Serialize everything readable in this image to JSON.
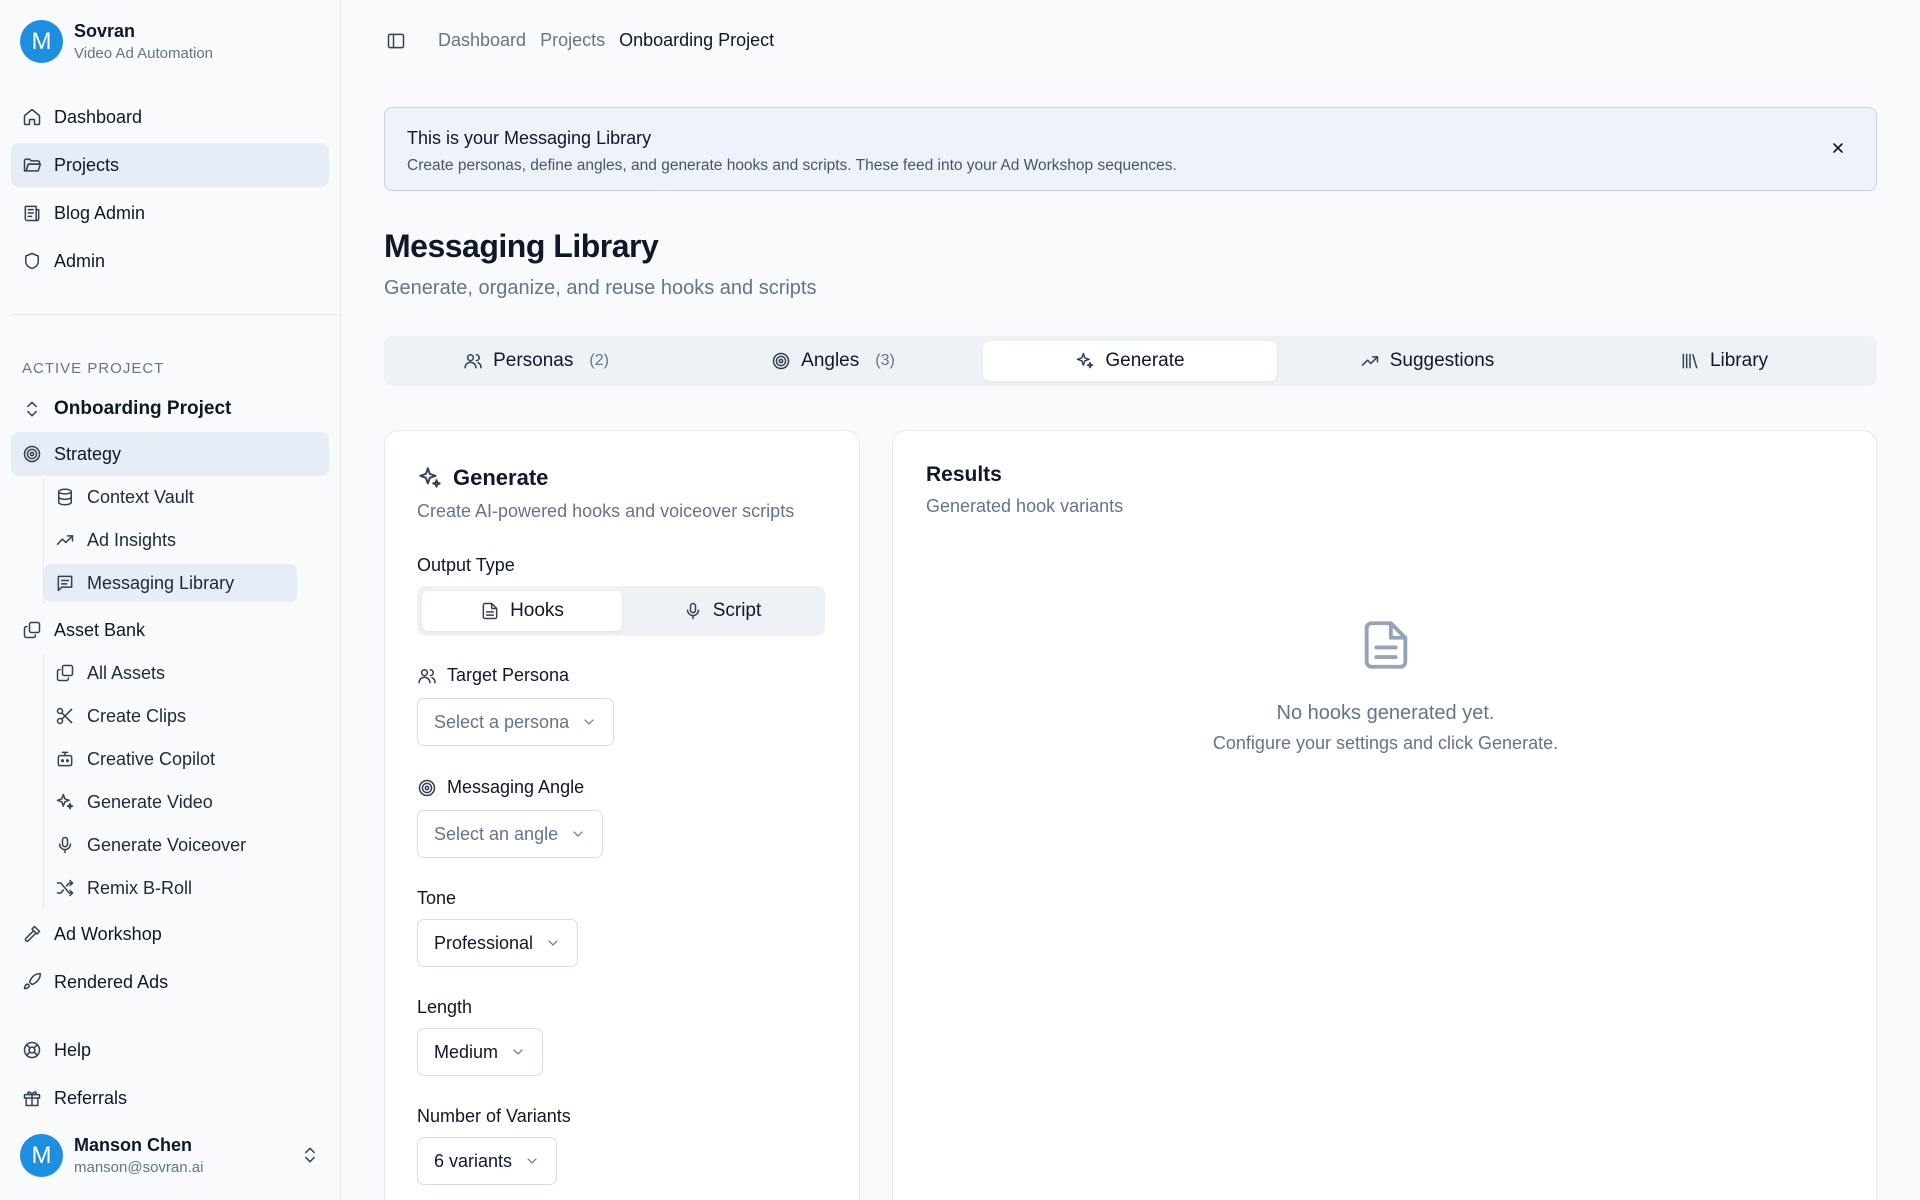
{
  "brand": {
    "initial": "M",
    "name": "Sovran",
    "subtitle": "Video Ad Automation"
  },
  "nav": [
    {
      "label": "Dashboard",
      "icon": "home-icon"
    },
    {
      "label": "Projects",
      "icon": "folder-icon"
    },
    {
      "label": "Blog Admin",
      "icon": "newspaper-icon"
    },
    {
      "label": "Admin",
      "icon": "shield-icon"
    }
  ],
  "active_project": {
    "section_label": "ACTIVE PROJECT",
    "name": "Onboarding Project",
    "strategy": {
      "label": "Strategy",
      "items": [
        "Context Vault",
        "Ad Insights",
        "Messaging Library"
      ]
    },
    "asset_bank": {
      "label": "Asset Bank",
      "items": [
        "All Assets",
        "Create Clips",
        "Creative Copilot",
        "Generate Video",
        "Generate Voiceover",
        "Remix B-Roll"
      ]
    },
    "ad_workshop": "Ad Workshop",
    "rendered_ads": "Rendered Ads"
  },
  "footer_nav": {
    "help": "Help",
    "referrals": "Referrals"
  },
  "user": {
    "initial": "M",
    "name": "Manson Chen",
    "email": "manson@sovran.ai"
  },
  "breadcrumb": [
    "Dashboard",
    "Projects",
    "Onboarding Project"
  ],
  "banner": {
    "title": "This is your Messaging Library",
    "description": "Create personas, define angles, and generate hooks and scripts. These feed into your Ad Workshop sequences."
  },
  "page": {
    "title": "Messaging Library",
    "subtitle": "Generate, organize, and reuse hooks and scripts"
  },
  "tabs": [
    {
      "label": "Personas",
      "count": "(2)",
      "icon": "users-icon"
    },
    {
      "label": "Angles",
      "count": "(3)",
      "icon": "target-icon"
    },
    {
      "label": "Generate",
      "count": "",
      "icon": "sparkles-icon",
      "active": true
    },
    {
      "label": "Suggestions",
      "count": "",
      "icon": "trending-up-icon"
    },
    {
      "label": "Library",
      "count": "",
      "icon": "library-icon"
    }
  ],
  "generate": {
    "title": "Generate",
    "description": "Create AI-powered hooks and voiceover scripts",
    "output_type": {
      "label": "Output Type",
      "options": [
        "Hooks",
        "Script"
      ],
      "selected": "Hooks"
    },
    "target_persona": {
      "label": "Target Persona",
      "placeholder": "Select a persona"
    },
    "messaging_angle": {
      "label": "Messaging Angle",
      "placeholder": "Select an angle"
    },
    "tone": {
      "label": "Tone",
      "value": "Professional"
    },
    "length": {
      "label": "Length",
      "value": "Medium"
    },
    "variants": {
      "label": "Number of Variants",
      "value": "6 variants"
    }
  },
  "results": {
    "title": "Results",
    "subtitle": "Generated hook variants",
    "empty_title": "No hooks generated yet.",
    "empty_desc": "Configure your settings and click Generate."
  }
}
